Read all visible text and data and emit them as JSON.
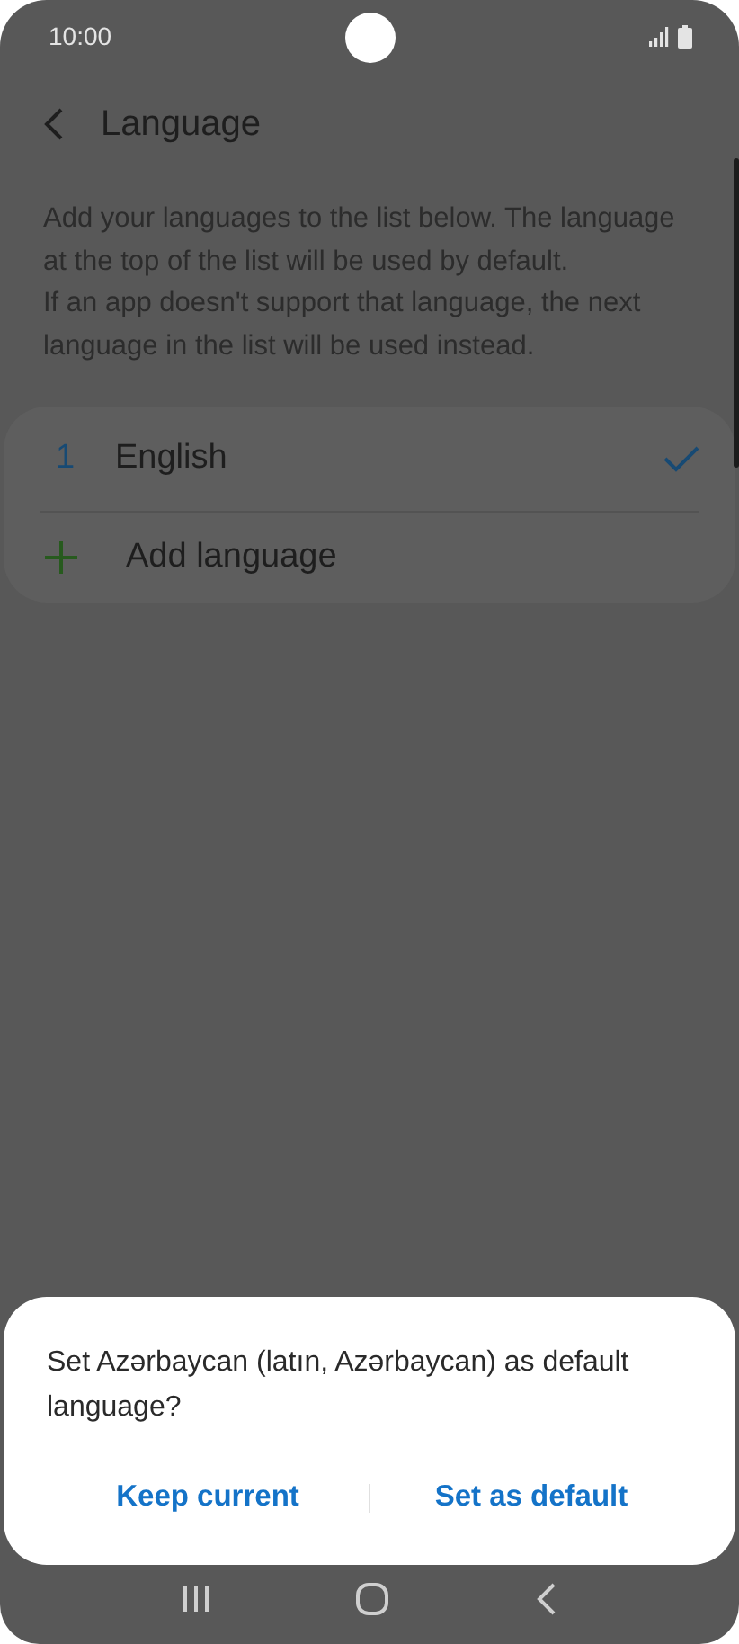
{
  "status_bar": {
    "time": "10:00"
  },
  "header": {
    "title": "Language"
  },
  "description": [
    "Add your languages to the list below. The language at the top of the list will be used by default.",
    "If an app doesn't support that language, the next language in the list will be used instead."
  ],
  "languages": [
    {
      "number": "1",
      "name": "English",
      "selected": true
    }
  ],
  "add_language": {
    "label": "Add language"
  },
  "dialog": {
    "message": "Set Azərbaycan (latın, Azərbaycan) as default language?",
    "buttons": [
      "Keep current",
      "Set as default"
    ]
  }
}
